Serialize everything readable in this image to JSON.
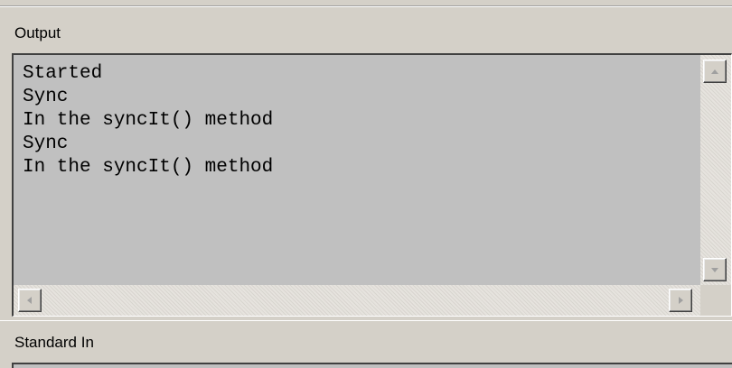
{
  "panels": {
    "output_label": "Output",
    "stdin_label": "Standard In"
  },
  "output": {
    "lines": [
      "Started",
      "Sync",
      "In the syncIt() method",
      "Sync",
      "In the syncIt() method"
    ]
  },
  "icons": {
    "scroll_up": "arrow-up-icon",
    "scroll_down": "arrow-down-icon",
    "scroll_left": "arrow-left-icon",
    "scroll_right": "arrow-right-icon"
  },
  "colors": {
    "panel_bg": "#d4d0c8",
    "output_bg": "#c0c0c0",
    "text": "#000000"
  }
}
